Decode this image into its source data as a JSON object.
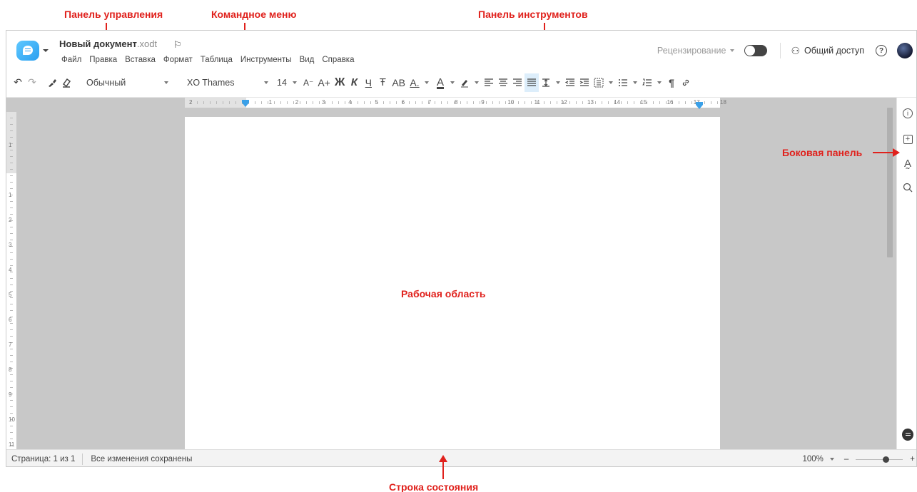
{
  "annotations": {
    "control_panel": "Панель управления",
    "command_menu": "Командное меню",
    "toolbar": "Панель инструментов",
    "sidebar": "Боковая панель",
    "workspace": "Рабочая область",
    "statusbar": "Строка состояния"
  },
  "header": {
    "doc_name": "Новый документ",
    "doc_ext": ".xodt",
    "menu": [
      "Файл",
      "Правка",
      "Вставка",
      "Формат",
      "Таблица",
      "Инструменты",
      "Вид",
      "Справка"
    ],
    "review_label": "Рецензирование",
    "share_label": "Общий доступ",
    "help": "?"
  },
  "toolbar": {
    "undo": "↶",
    "redo": "↷",
    "paragraph_style": "Обычный",
    "font_name": "XO Thames",
    "font_size": "14",
    "decrease_font": "A⁻",
    "increase_font": "A+",
    "bold": "Ж",
    "italic": "К",
    "underline": "Ч",
    "strike": "Ŧ",
    "caps": "АВ",
    "sub_super": "A.",
    "font_color": "A",
    "pilcrow": "¶"
  },
  "ruler": {
    "h_labels": [
      "2",
      "1",
      "1",
      "2",
      "3",
      "4",
      "5",
      "6",
      "7",
      "8",
      "9",
      "10",
      "11",
      "12",
      "13",
      "14",
      "15",
      "16",
      "17",
      "18"
    ],
    "v_labels": [
      "1",
      "1",
      "2",
      "3",
      "4",
      "5",
      "6",
      "7",
      "8",
      "9",
      "10",
      "11"
    ]
  },
  "status": {
    "page_info": "Страница: 1 из 1",
    "saved": "Все изменения сохранены",
    "zoom": "100%",
    "minus": "–",
    "plus": "+"
  },
  "colors": {
    "annotation": "#e0211c",
    "accent": "#3aa0e8",
    "workspace_bg": "#c8c8c8"
  }
}
